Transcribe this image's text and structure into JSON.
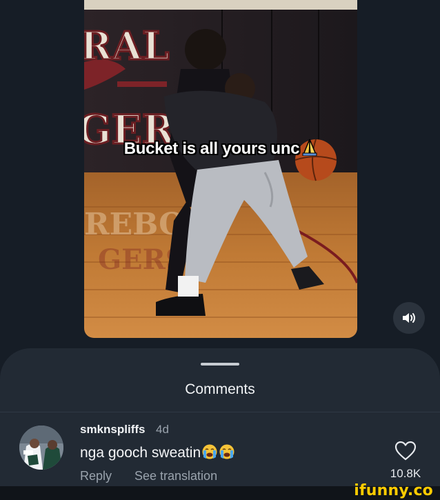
{
  "video": {
    "caption": "Bucket is all yours unc",
    "caption_emoji": "folded-hands",
    "sound_button_icon": "speaker-icon"
  },
  "comments": {
    "title": "Comments",
    "items": [
      {
        "username": "smknspliffs",
        "time_ago": "4d",
        "text": "nga gooch sweatin",
        "text_emoji": [
          "loudly-crying-face",
          "loudly-crying-face"
        ],
        "reply_label": "Reply",
        "translate_label": "See translation",
        "like_count": "10.8K"
      }
    ]
  },
  "watermark": "ifunny.co",
  "colors": {
    "background": "#161d26",
    "sheet": "#222a34",
    "muted_text": "#9aa3ad",
    "watermark": "#ffcc00"
  }
}
